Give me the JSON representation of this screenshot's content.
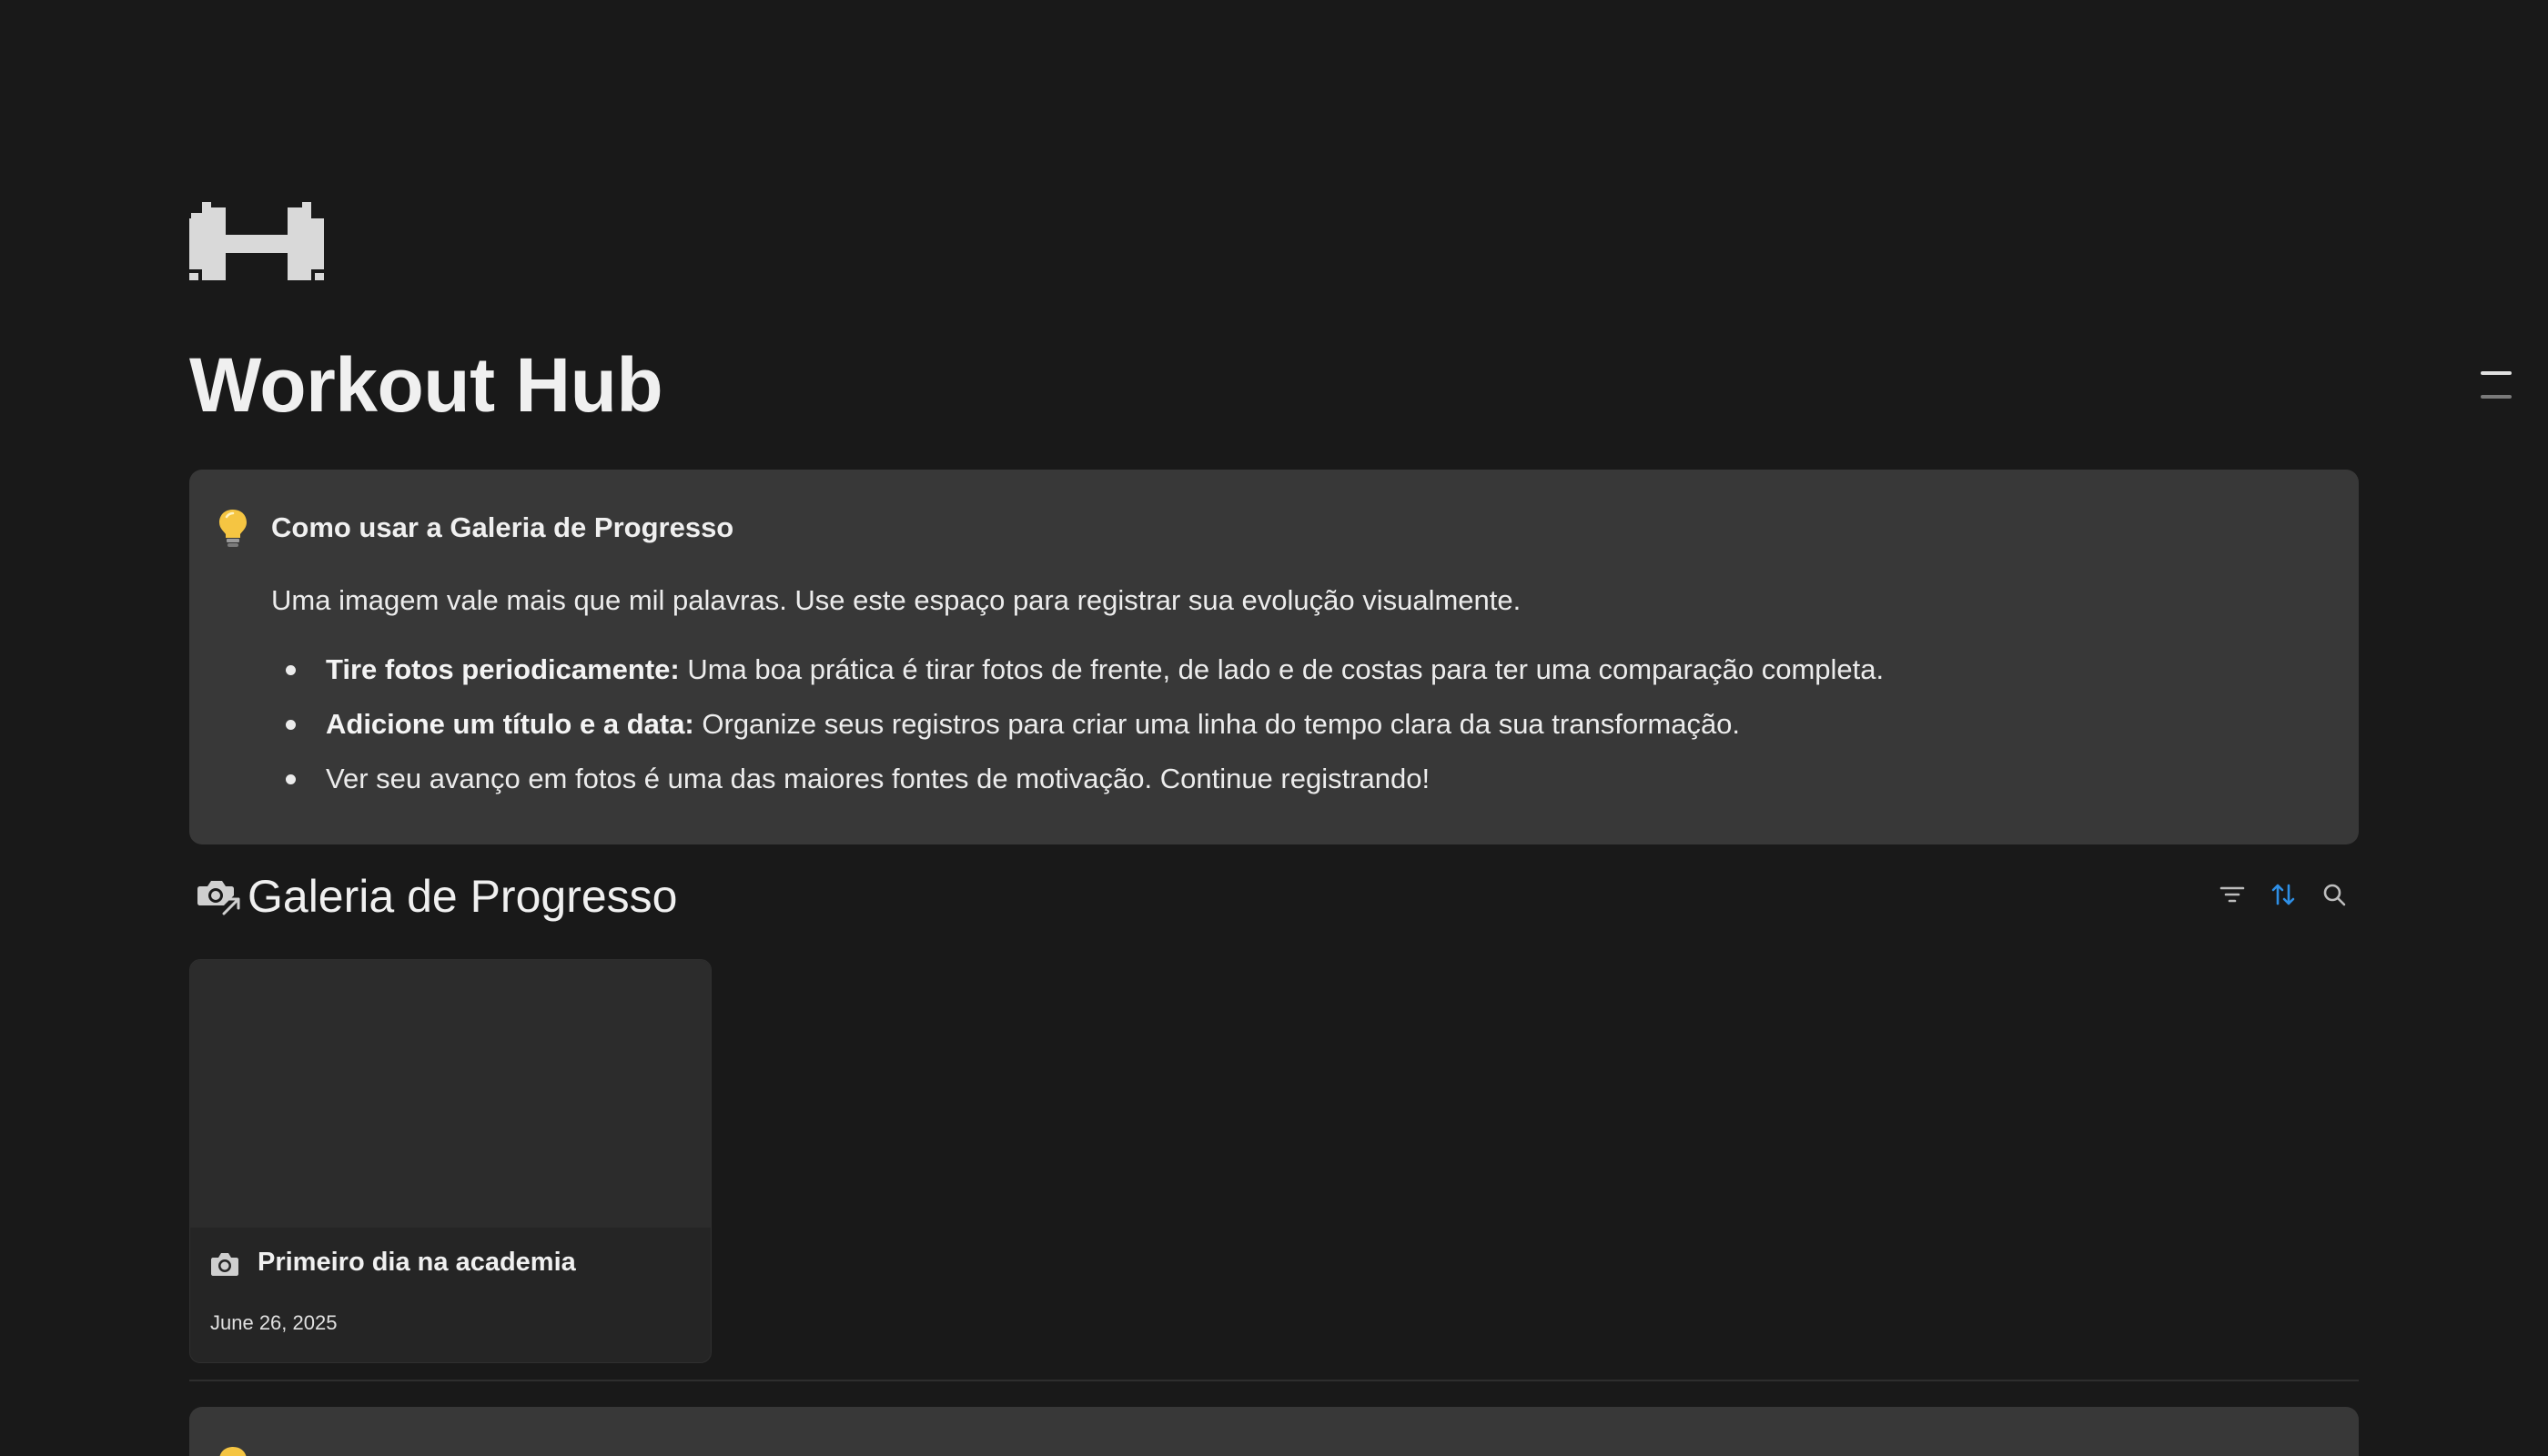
{
  "page": {
    "title": "Workout Hub",
    "icon": "dumbbell-icon"
  },
  "callout": {
    "icon": "lightbulb-icon",
    "heading": "Como usar a Galeria de Progresso",
    "intro": "Uma imagem vale mais que mil palavras. Use este espaço para registrar sua evolução visualmente.",
    "bullets": [
      {
        "bold": "Tire fotos periodicamente:",
        "text": " Uma boa prática é tirar fotos de frente, de lado e de costas para ter uma comparação completa."
      },
      {
        "bold": "Adicione um título e a data:",
        "text": " Organize seus registros para criar uma linha do tempo clara da sua transformação."
      },
      {
        "bold": "",
        "text": "Ver seu avanço em fotos é uma das maiores fontes de motivação. Continue registrando!"
      }
    ]
  },
  "gallery": {
    "icon": "camera-with-arrow-icon",
    "title": "Galeria de Progresso",
    "toolbar": {
      "filter_icon": "filter-icon",
      "sort_icon": "sort-icon",
      "search_icon": "search-icon",
      "sort_active_color": "#2e8fe6"
    },
    "cards": [
      {
        "icon": "camera-icon",
        "title": "Primeiro dia na academia",
        "date": "June 26, 2025"
      }
    ]
  },
  "colors": {
    "background": "#191919",
    "callout_bg": "#383838",
    "card_bg": "#252525",
    "accent": "#2e8fe6",
    "bulb": "#f5c542"
  }
}
